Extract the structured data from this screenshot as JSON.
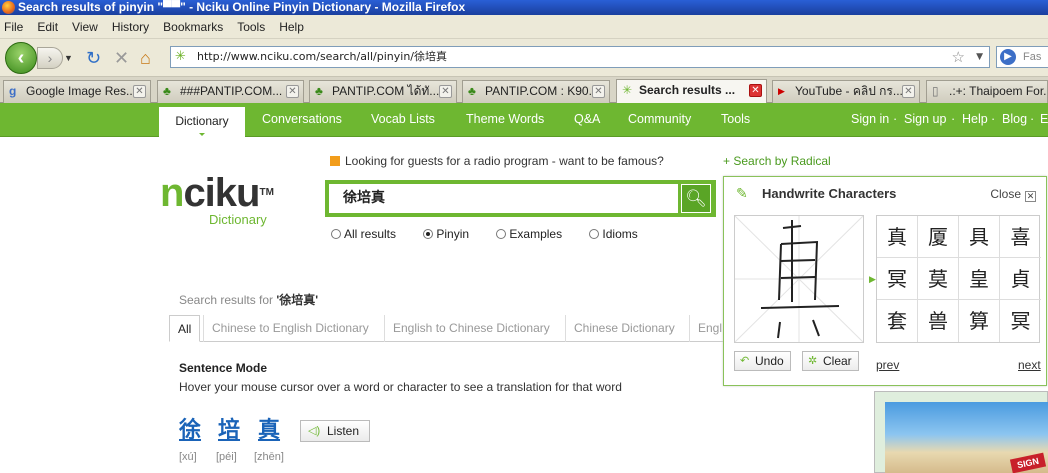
{
  "window": {
    "title": "Search results of pinyin \"▀▀\" - Nciku Online Pinyin Dictionary - Mozilla Firefox"
  },
  "menu": [
    "File",
    "Edit",
    "View",
    "History",
    "Bookmarks",
    "Tools",
    "Help"
  ],
  "address": {
    "url": "http://www.nciku.com/search/all/pinyin/徐培真"
  },
  "search_engine": {
    "placeholder": "Fas"
  },
  "tabs": [
    {
      "label": "Google Image Res...",
      "icon": "google-icon"
    },
    {
      "label": "###PANTIP.COM...",
      "icon": "cactus-icon"
    },
    {
      "label": "PANTIP.COM ได้ทั...",
      "icon": "cactus-icon"
    },
    {
      "label": "PANTIP.COM : K90...",
      "icon": "cactus-icon"
    },
    {
      "label": "Search results ...",
      "icon": "nciku-icon",
      "active": true
    },
    {
      "label": "YouTube - คลิป กร...",
      "icon": "youtube-icon"
    },
    {
      "label": ".:+: Thaipoem For...",
      "icon": "page-icon"
    }
  ],
  "site_nav": {
    "items": [
      "Dictionary",
      "Conversations",
      "Vocab Lists",
      "Theme Words",
      "Q&A",
      "Community",
      "Tools"
    ],
    "right": [
      "Sign in",
      "Sign up",
      "Help",
      "Blog",
      "E"
    ],
    "separator": "·"
  },
  "logo": {
    "n": "n",
    "rest": "ciku",
    "tm": "TM",
    "sub": "Dictionary"
  },
  "notice": "Looking for guests for a radio program - want to be famous?",
  "search": {
    "value": "徐培真"
  },
  "search_options": [
    {
      "label": "All results",
      "checked": false
    },
    {
      "label": "Pinyin",
      "checked": true
    },
    {
      "label": "Examples",
      "checked": false
    },
    {
      "label": "Idioms",
      "checked": false
    }
  ],
  "radical_link": "+ Search by Radical",
  "results": {
    "prefix": "Search results for ",
    "query": "'徐培真'",
    "tabs": [
      "All",
      "Chinese to English Dictionary",
      "English to Chinese Dictionary",
      "Chinese Dictionary",
      "Engl"
    ],
    "sentence_mode_title": "Sentence Mode",
    "sentence_mode_hint": "Hover your mouse cursor over a word or character to see a translation for that word",
    "chars": [
      {
        "hanzi": "徐",
        "pinyin": "[xú]"
      },
      {
        "hanzi": "培",
        "pinyin": "[péi]"
      },
      {
        "hanzi": "真",
        "pinyin": "[zhēn]"
      }
    ],
    "listen": "Listen"
  },
  "handwrite": {
    "title": "Handwrite Characters",
    "close": "Close",
    "candidates": [
      "真",
      "厦",
      "具",
      "喜",
      "冥",
      "莫",
      "皇",
      "貞",
      "套",
      "兽",
      "算",
      "冥"
    ],
    "undo": "Undo",
    "clear": "Clear",
    "prev": "prev",
    "next": "next"
  },
  "ad": {
    "badge": "SIGN"
  },
  "colors": {
    "green": "#6eb731",
    "link_blue": "#1a63b8",
    "title_blue": "#2a5fd6"
  }
}
